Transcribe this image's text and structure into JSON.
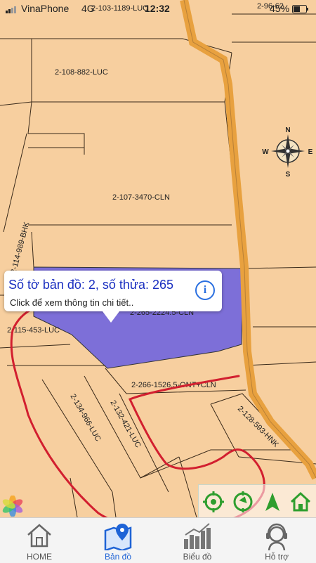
{
  "status": {
    "carrier": "VinaPhone",
    "network": "4G",
    "time": "12:32",
    "battery": "45%"
  },
  "map": {
    "parcel_labels": [
      {
        "id": "p1",
        "text": "2-108-882-LUC"
      },
      {
        "id": "p2",
        "text": "2-107-3470-CLN"
      },
      {
        "id": "p3",
        "text": "2-114-989-BHK"
      },
      {
        "id": "p4",
        "text": "2-115-453-LUC"
      },
      {
        "id": "p5",
        "text": "2-266-1526.5-ONT+CLN"
      },
      {
        "id": "p6",
        "text": "2-134-966-LUC"
      },
      {
        "id": "p7",
        "text": "2-132-421-LUC"
      },
      {
        "id": "p8",
        "text": "2-128-593-HNK"
      },
      {
        "id": "p9",
        "text": "2-103-1189-LUC"
      },
      {
        "id": "p10",
        "text": "2-96-62"
      },
      {
        "id": "p11",
        "text": "2-265-2224.5-CLN"
      }
    ],
    "compass": {
      "n": "N",
      "s": "S",
      "e": "E",
      "w": "W"
    }
  },
  "popup": {
    "title": "Số tờ bản đồ: 2, số thửa: 265",
    "subtitle": "Click để xem thông tin chi tiết..",
    "info_icon": "info-icon"
  },
  "toolbar": {
    "icons": [
      "locate-icon",
      "refresh-icon",
      "navigate-icon",
      "home-outline-icon"
    ]
  },
  "tabs": [
    {
      "label": "HOME",
      "icon": "home-icon"
    },
    {
      "label": "Bản đồ",
      "icon": "map-pin-icon",
      "active": true
    },
    {
      "label": "Biểu đồ",
      "icon": "bar-chart-icon"
    },
    {
      "label": "Hỗ trợ",
      "icon": "support-icon"
    }
  ]
}
